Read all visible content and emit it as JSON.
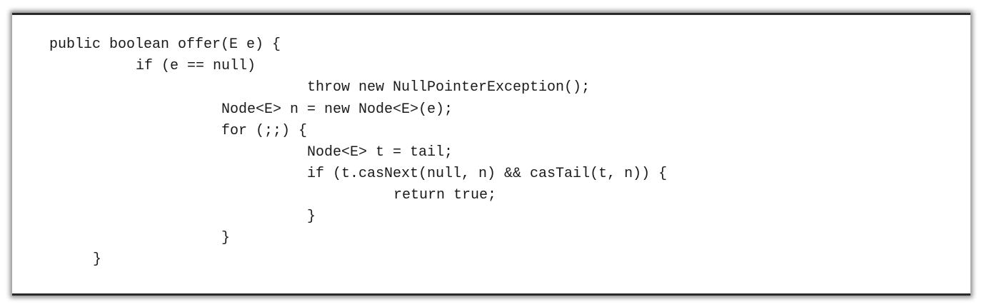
{
  "code": {
    "lines": [
      "public boolean offer(E e) {",
      "if (e == null)",
      "throw new NullPointerException();",
      "Node<E> n = new Node<E>(e);",
      "for (;;) {",
      "Node<E> t = tail;",
      "if (t.casNext(null, n) && casTail(t, n)) {",
      "return true;",
      "}",
      "}",
      "}"
    ]
  }
}
